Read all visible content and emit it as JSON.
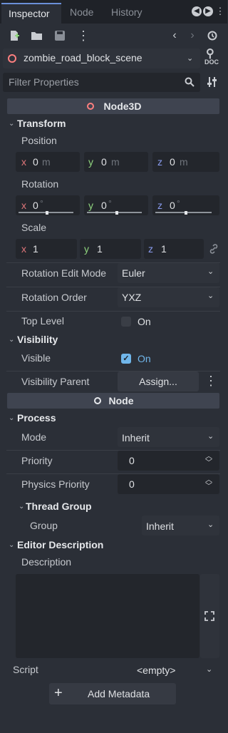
{
  "tabs": [
    "Inspector",
    "Node",
    "History"
  ],
  "scene": {
    "name": "zombie_road_block_scene",
    "doc_label": "DOC"
  },
  "filter": {
    "placeholder": "Filter Properties"
  },
  "node3d": {
    "title": "Node3D",
    "transform": {
      "title": "Transform",
      "position": {
        "label": "Position",
        "x": "0",
        "y": "0",
        "z": "0",
        "unit": "m"
      },
      "rotation": {
        "label": "Rotation",
        "x": "0",
        "y": "0",
        "z": "0",
        "unit": "°"
      },
      "scale": {
        "label": "Scale",
        "x": "1",
        "y": "1",
        "z": "1"
      },
      "edit_mode": {
        "label": "Rotation Edit Mode",
        "value": "Euler"
      },
      "order": {
        "label": "Rotation Order",
        "value": "YXZ"
      },
      "top_level": {
        "label": "Top Level",
        "value": "On",
        "checked": false
      }
    },
    "visibility": {
      "title": "Visibility",
      "visible": {
        "label": "Visible",
        "value": "On",
        "checked": true
      },
      "parent": {
        "label": "Visibility Parent",
        "value": "Assign..."
      }
    }
  },
  "node": {
    "title": "Node",
    "process": {
      "title": "Process",
      "mode": {
        "label": "Mode",
        "value": "Inherit"
      },
      "priority": {
        "label": "Priority",
        "value": "0"
      },
      "physics_priority": {
        "label": "Physics Priority",
        "value": "0"
      },
      "thread_group": {
        "title": "Thread Group",
        "group": {
          "label": "Group",
          "value": "Inherit"
        }
      }
    },
    "editor_description": {
      "title": "Editor Description",
      "description": {
        "label": "Description",
        "value": ""
      }
    }
  },
  "script": {
    "label": "Script",
    "value": "<empty>"
  },
  "add_metadata": "Add Metadata",
  "axis_letters": {
    "x": "x",
    "y": "y",
    "z": "z"
  },
  "colors": {
    "x_axis": "#e0767a",
    "y_axis": "#8fd47e",
    "z_axis": "#8a9cf0",
    "accent": "#70b6ea",
    "node3d_icon": "#fc7f7f"
  }
}
